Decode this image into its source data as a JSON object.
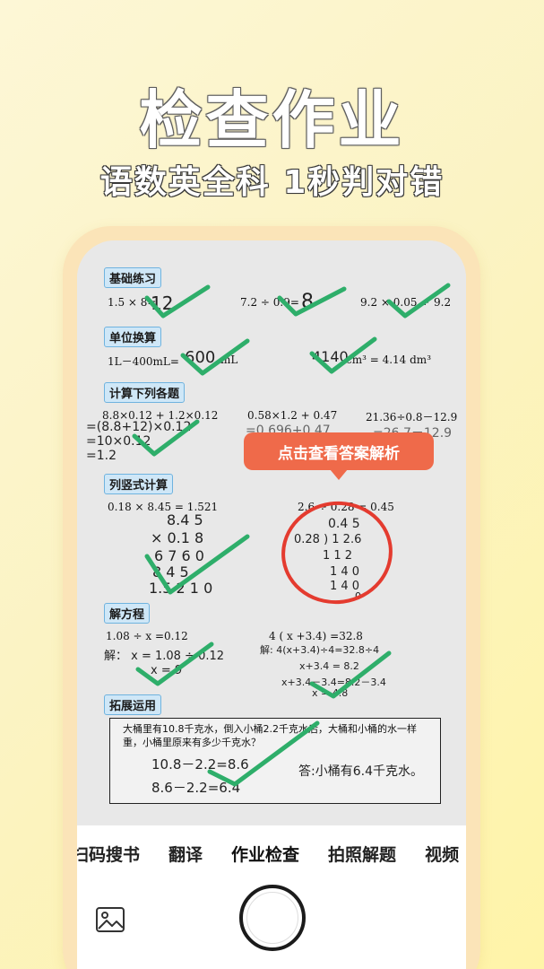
{
  "hero": {
    "title": "检查作业",
    "subtitle": "语数英全科 1秒判对错"
  },
  "worksheet": {
    "sections": [
      {
        "label": "基础练习"
      },
      {
        "label": "单位换算"
      },
      {
        "label": "计算下列各题"
      },
      {
        "label": "列竖式计算"
      },
      {
        "label": "解方程"
      },
      {
        "label": "拓展运用"
      }
    ],
    "basic": {
      "q1": "1.5 × 8=",
      "a1": "12",
      "q2": "7.2 ÷ 0.9=",
      "a2": "8",
      "q3": "9.2 × 0.05 ÷",
      "a3": "9.2"
    },
    "units": {
      "q1a": "1L－400mL=",
      "a1": "600",
      "q1b": "mL",
      "a2": "4140",
      "q2b": "cm³ = 4.14 dm³"
    },
    "calc": {
      "q1": "8.8×0.12 + 1.2×0.12",
      "w1": "=(8.8+12)×0.12",
      "w2": "=10×0.12",
      "w3": "=1.2",
      "q2": "0.58×1.2 + 0.47",
      "w4": "=0.696+0.47",
      "q3": "21.36÷0.8－12.9",
      "w5": "=26.7－12.9"
    },
    "vertical": {
      "q1": "0.18 × 8.45 = 1.521",
      "r1": "8.4 5",
      "r2": "× 0.1 8",
      "r3": "6 7 6 0",
      "r4": "8 4 5",
      "r5": "1.5 2 1 0",
      "q2": "2.6 ÷ 0.28 = 0.45",
      "d1": "0.4 5",
      "d2": "0.28 ) 1 2.6",
      "d3": "1 1 2",
      "d4": "1 4 0",
      "d5": "1 4 0",
      "d6": "0"
    },
    "equation": {
      "q1": "1.08 ÷ x =0.12",
      "s1": "解： x = 1.08 ÷ 0.12",
      "s2": "x = 9",
      "q2": "4 ( x +3.4) =32.8",
      "s3": "解: 4(x+3.4)÷4=32.8÷4",
      "s4": "x+3.4 = 8.2",
      "s5": "x+3.4－3.4=8.2－3.4",
      "s6": "x = 4.8"
    },
    "word_problem": {
      "text": "大桶里有10.8千克水，倒入小桶2.2千克水后，大桶和小桶的水一样重，小桶里原来有多少千克水？",
      "w1": "10.8－2.2=8.6",
      "w2": "8.6－2.2=6.4",
      "answer": "答:小桶有6.4千克水。"
    }
  },
  "tooltip": {
    "text": "点击查看答案解析"
  },
  "modes": {
    "tabs": [
      {
        "label": "扫码搜书"
      },
      {
        "label": "翻译"
      },
      {
        "label": "作业检查"
      },
      {
        "label": "拍照解题"
      },
      {
        "label": "视频"
      }
    ],
    "active_index": 2
  },
  "colors": {
    "check": "#2eae6a",
    "circle": "#e43b2f",
    "tooltip": "#ef6a4a"
  }
}
